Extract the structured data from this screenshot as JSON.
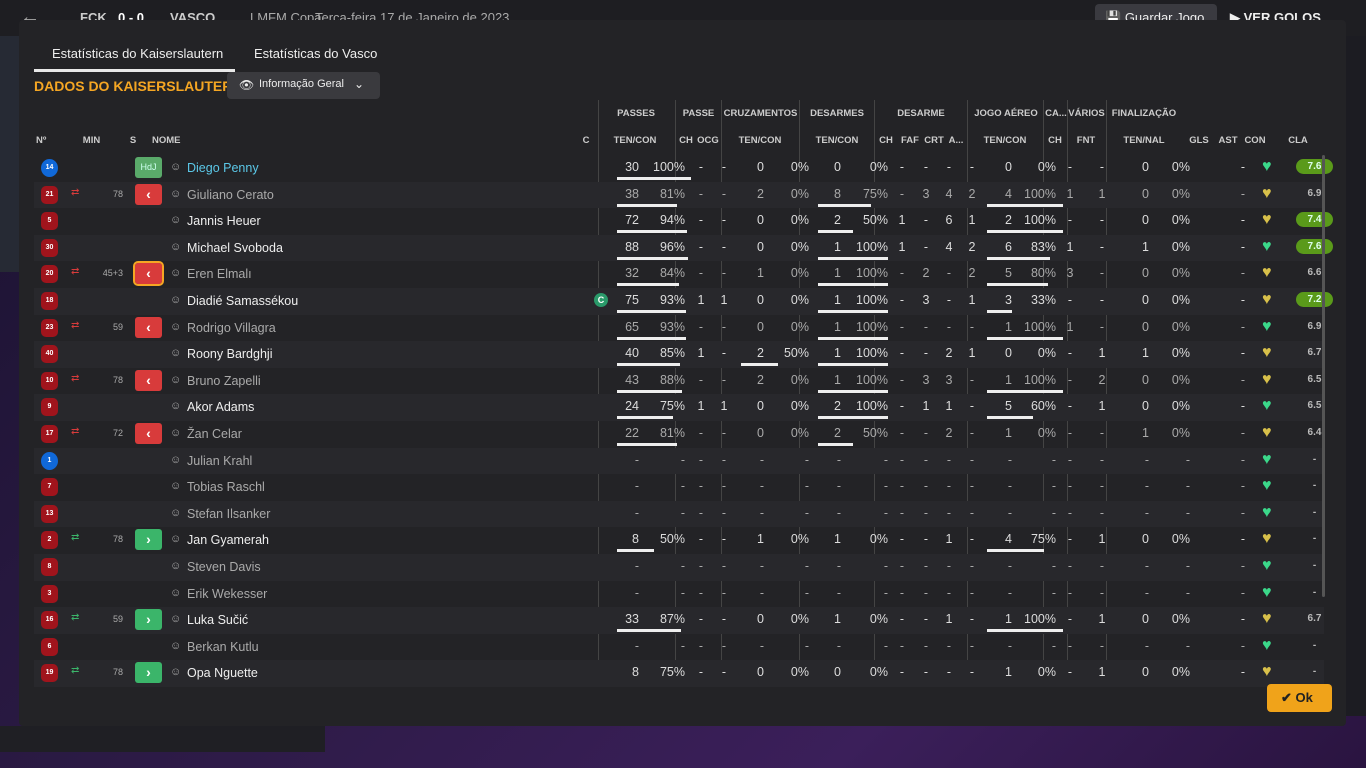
{
  "topbar": {
    "team1": "FCK",
    "score": "0 - 0",
    "team2": "VASCO",
    "competition": "LMFM Copa",
    "date": "Terça-feira 17 de Janeiro de 2023",
    "save_label": "Guardar Jogo",
    "goals_label": "VER GOLOS"
  },
  "tabs": [
    "Estatísticas do Kaiserslautern",
    "Estatísticas do Vasco"
  ],
  "title": "DADOS DO KAISERSLAUTERN",
  "view_select": "Informação Geral",
  "groups": [
    "PASSES",
    "PASSE",
    "CRUZAMENTOS",
    "DESARMES",
    "DESARME",
    "JOGO AÉREO",
    "CA...",
    "VÁRIOS",
    "FINALIZAÇÃO"
  ],
  "columns": {
    "no": "Nº",
    "min": "MIN",
    "s": "S",
    "name": "NOME",
    "c": "C",
    "passes": "TEN/CON",
    "passe_ch": "CH",
    "passe_ocg": "OCG",
    "cruz": "TEN/CON",
    "desarmes": "TEN/CON",
    "des_ch": "CH",
    "des_faf": "FAF",
    "des_crt": "CRT",
    "des_a": "A...",
    "aereo": "TEN/CON",
    "ca_ch": "CH",
    "fnt": "FNT",
    "fin": "TEN/NAL",
    "gls": "GLS",
    "ast": "AST",
    "con": "CON",
    "cla": "CLA"
  },
  "colors": {
    "accent": "#f5a623",
    "good_rating": "#5a9a1a",
    "out": "#d83b3b",
    "in": "#3bb56a"
  },
  "players": [
    {
      "no": "14",
      "kit": "blue",
      "sub": "",
      "min": "",
      "s": "HdJ",
      "name": "Diego Penny",
      "cap": "",
      "p1": "30",
      "p2": "100%",
      "pb": 1.0,
      "ch": "-",
      "ocg": "-",
      "cr1": "0",
      "cr2": "0%",
      "d1": "0",
      "d2": "0%",
      "db": 0,
      "dch": "-",
      "faf": "-",
      "crt": "-",
      "da": "-",
      "a1": "0",
      "a2": "0%",
      "ab": 0,
      "cach": "-",
      "fnt": "-",
      "f1": "0",
      "f2": "0%",
      "gls": "",
      "ast": "-",
      "cla": "7.6",
      "good": true,
      "hl": true
    },
    {
      "no": "21",
      "kit": "red",
      "sub": "out",
      "min": "78",
      "s": "out",
      "name": "Giuliano Cerato",
      "cap": "",
      "p1": "38",
      "p2": "81%",
      "pb": 0.81,
      "ch": "-",
      "ocg": "-",
      "cr1": "2",
      "cr2": "0%",
      "d1": "8",
      "d2": "75%",
      "db": 0.75,
      "dch": "-",
      "faf": "3",
      "crt": "4",
      "da": "2",
      "a1": "4",
      "a2": "100%",
      "ab": 1.0,
      "cach": "1",
      "fnt": "1",
      "f1": "0",
      "f2": "0%",
      "gls": "",
      "ast": "-",
      "cla": "6.9",
      "good": false,
      "dim": true
    },
    {
      "no": "5",
      "kit": "red",
      "sub": "",
      "min": "",
      "s": "",
      "name": "Jannis Heuer",
      "cap": "",
      "p1": "72",
      "p2": "94%",
      "pb": 0.94,
      "ch": "-",
      "ocg": "-",
      "cr1": "0",
      "cr2": "0%",
      "d1": "2",
      "d2": "50%",
      "db": 0.5,
      "dch": "1",
      "faf": "-",
      "crt": "6",
      "da": "1",
      "a1": "2",
      "a2": "100%",
      "ab": 1.0,
      "cach": "-",
      "fnt": "-",
      "f1": "0",
      "f2": "0%",
      "gls": "",
      "ast": "-",
      "cla": "7.4",
      "good": true
    },
    {
      "no": "30",
      "kit": "red",
      "sub": "",
      "min": "",
      "s": "",
      "name": "Michael Svoboda",
      "cap": "",
      "p1": "88",
      "p2": "96%",
      "pb": 0.96,
      "ch": "-",
      "ocg": "-",
      "cr1": "0",
      "cr2": "0%",
      "d1": "1",
      "d2": "100%",
      "db": 1.0,
      "dch": "1",
      "faf": "-",
      "crt": "4",
      "da": "2",
      "a1": "6",
      "a2": "83%",
      "ab": 0.83,
      "cach": "1",
      "fnt": "-",
      "f1": "1",
      "f2": "0%",
      "gls": "",
      "ast": "-",
      "cla": "7.6",
      "good": true
    },
    {
      "no": "20",
      "kit": "red",
      "sub": "out",
      "min": "45+3",
      "s": "out",
      "name": "Eren Elmalı",
      "cap": "",
      "p1": "32",
      "p2": "84%",
      "pb": 0.84,
      "ch": "-",
      "ocg": "-",
      "cr1": "1",
      "cr2": "0%",
      "d1": "1",
      "d2": "100%",
      "db": 1.0,
      "dch": "-",
      "faf": "2",
      "crt": "-",
      "da": "2",
      "a1": "5",
      "a2": "80%",
      "ab": 0.8,
      "cach": "3",
      "fnt": "-",
      "f1": "0",
      "f2": "0%",
      "gls": "",
      "ast": "-",
      "cla": "6.6",
      "good": false,
      "dim": true
    },
    {
      "no": "18",
      "kit": "red",
      "sub": "",
      "min": "",
      "s": "",
      "name": "Diadié Samassékou",
      "cap": "C",
      "p1": "75",
      "p2": "93%",
      "pb": 0.93,
      "ch": "1",
      "ocg": "1",
      "cr1": "0",
      "cr2": "0%",
      "d1": "1",
      "d2": "100%",
      "db": 1.0,
      "dch": "-",
      "faf": "3",
      "crt": "-",
      "da": "1",
      "a1": "3",
      "a2": "33%",
      "ab": 0.33,
      "cach": "-",
      "fnt": "-",
      "f1": "0",
      "f2": "0%",
      "gls": "",
      "ast": "-",
      "cla": "7.2",
      "good": true
    },
    {
      "no": "23",
      "kit": "red",
      "sub": "out",
      "min": "59",
      "s": "out",
      "name": "Rodrigo Villagra",
      "cap": "",
      "p1": "65",
      "p2": "93%",
      "pb": 0.93,
      "ch": "-",
      "ocg": "-",
      "cr1": "0",
      "cr2": "0%",
      "d1": "1",
      "d2": "100%",
      "db": 1.0,
      "dch": "-",
      "faf": "-",
      "crt": "-",
      "da": "-",
      "a1": "1",
      "a2": "100%",
      "ab": 1.0,
      "cach": "1",
      "fnt": "-",
      "f1": "0",
      "f2": "0%",
      "gls": "",
      "ast": "-",
      "cla": "6.9",
      "good": false,
      "dim": true
    },
    {
      "no": "40",
      "kit": "red",
      "sub": "",
      "min": "",
      "s": "",
      "name": "Roony Bardghji",
      "cap": "",
      "p1": "40",
      "p2": "85%",
      "pb": 0.85,
      "ch": "1",
      "ocg": "-",
      "cr1": "2",
      "cr2": "50%",
      "d1": "1",
      "d2": "100%",
      "db": 1.0,
      "dch": "-",
      "faf": "-",
      "crt": "2",
      "da": "1",
      "a1": "0",
      "a2": "0%",
      "ab": 0,
      "cach": "-",
      "fnt": "1",
      "f1": "1",
      "f2": "0%",
      "gls": "",
      "ast": "-",
      "cla": "6.7",
      "good": false,
      "crb": 0.5
    },
    {
      "no": "10",
      "kit": "red",
      "sub": "out",
      "min": "78",
      "s": "out",
      "name": "Bruno Zapelli",
      "cap": "",
      "p1": "43",
      "p2": "88%",
      "pb": 0.88,
      "ch": "-",
      "ocg": "-",
      "cr1": "2",
      "cr2": "0%",
      "d1": "1",
      "d2": "100%",
      "db": 1.0,
      "dch": "-",
      "faf": "3",
      "crt": "3",
      "da": "-",
      "a1": "1",
      "a2": "100%",
      "ab": 1.0,
      "cach": "-",
      "fnt": "2",
      "f1": "0",
      "f2": "0%",
      "gls": "",
      "ast": "-",
      "cla": "6.5",
      "good": false,
      "dim": true
    },
    {
      "no": "9",
      "kit": "red",
      "sub": "",
      "min": "",
      "s": "",
      "name": "Akor Adams",
      "cap": "",
      "p1": "24",
      "p2": "75%",
      "pb": 0.75,
      "ch": "1",
      "ocg": "1",
      "cr1": "0",
      "cr2": "0%",
      "d1": "2",
      "d2": "100%",
      "db": 1.0,
      "dch": "-",
      "faf": "1",
      "crt": "1",
      "da": "-",
      "a1": "5",
      "a2": "60%",
      "ab": 0.6,
      "cach": "-",
      "fnt": "1",
      "f1": "0",
      "f2": "0%",
      "gls": "",
      "ast": "-",
      "cla": "6.5",
      "good": false
    },
    {
      "no": "17",
      "kit": "red",
      "sub": "out",
      "min": "72",
      "s": "out",
      "name": "Žan Celar",
      "cap": "",
      "p1": "22",
      "p2": "81%",
      "pb": 0.81,
      "ch": "-",
      "ocg": "-",
      "cr1": "0",
      "cr2": "0%",
      "d1": "2",
      "d2": "50%",
      "db": 0.5,
      "dch": "-",
      "faf": "-",
      "crt": "2",
      "da": "-",
      "a1": "1",
      "a2": "0%",
      "ab": 0,
      "cach": "-",
      "fnt": "-",
      "f1": "1",
      "f2": "0%",
      "gls": "",
      "ast": "-",
      "cla": "6.4",
      "good": false,
      "dim": true
    },
    {
      "no": "1",
      "kit": "blue",
      "sub": "",
      "min": "",
      "s": "",
      "name": "Julian Krahl",
      "cap": "",
      "p1": "-",
      "p2": "-",
      "pb": 0,
      "ch": "-",
      "ocg": "-",
      "cr1": "-",
      "cr2": "-",
      "d1": "-",
      "d2": "-",
      "db": 0,
      "dch": "-",
      "faf": "-",
      "crt": "-",
      "da": "-",
      "a1": "-",
      "a2": "-",
      "ab": 0,
      "cach": "-",
      "fnt": "-",
      "f1": "-",
      "f2": "-",
      "gls": "",
      "ast": "-",
      "cla": "-",
      "good": false,
      "dim": true
    },
    {
      "no": "7",
      "kit": "red",
      "sub": "",
      "min": "",
      "s": "",
      "name": "Tobias Raschl",
      "cap": "",
      "p1": "-",
      "p2": "-",
      "pb": 0,
      "ch": "-",
      "ocg": "-",
      "cr1": "-",
      "cr2": "-",
      "d1": "-",
      "d2": "-",
      "db": 0,
      "dch": "-",
      "faf": "-",
      "crt": "-",
      "da": "-",
      "a1": "-",
      "a2": "-",
      "ab": 0,
      "cach": "-",
      "fnt": "-",
      "f1": "-",
      "f2": "-",
      "gls": "",
      "ast": "-",
      "cla": "-",
      "good": false,
      "dim": true
    },
    {
      "no": "13",
      "kit": "red",
      "sub": "",
      "min": "",
      "s": "",
      "name": "Stefan Ilsanker",
      "cap": "",
      "p1": "-",
      "p2": "-",
      "pb": 0,
      "ch": "-",
      "ocg": "-",
      "cr1": "-",
      "cr2": "-",
      "d1": "-",
      "d2": "-",
      "db": 0,
      "dch": "-",
      "faf": "-",
      "crt": "-",
      "da": "-",
      "a1": "-",
      "a2": "-",
      "ab": 0,
      "cach": "-",
      "fnt": "-",
      "f1": "-",
      "f2": "-",
      "gls": "",
      "ast": "-",
      "cla": "-",
      "good": false,
      "dim": true
    },
    {
      "no": "2",
      "kit": "red",
      "sub": "in",
      "min": "78",
      "s": "in",
      "name": "Jan Gyamerah",
      "cap": "",
      "p1": "8",
      "p2": "50%",
      "pb": 0.5,
      "ch": "-",
      "ocg": "-",
      "cr1": "1",
      "cr2": "0%",
      "d1": "1",
      "d2": "0%",
      "db": 0,
      "dch": "-",
      "faf": "-",
      "crt": "1",
      "da": "-",
      "a1": "4",
      "a2": "75%",
      "ab": 0.75,
      "cach": "-",
      "fnt": "1",
      "f1": "0",
      "f2": "0%",
      "gls": "",
      "ast": "-",
      "cla": "-",
      "good": false
    },
    {
      "no": "8",
      "kit": "red",
      "sub": "",
      "min": "",
      "s": "",
      "name": "Steven Davis",
      "cap": "",
      "p1": "-",
      "p2": "-",
      "pb": 0,
      "ch": "-",
      "ocg": "-",
      "cr1": "-",
      "cr2": "-",
      "d1": "-",
      "d2": "-",
      "db": 0,
      "dch": "-",
      "faf": "-",
      "crt": "-",
      "da": "-",
      "a1": "-",
      "a2": "-",
      "ab": 0,
      "cach": "-",
      "fnt": "-",
      "f1": "-",
      "f2": "-",
      "gls": "",
      "ast": "-",
      "cla": "-",
      "good": false,
      "dim": true
    },
    {
      "no": "3",
      "kit": "red",
      "sub": "",
      "min": "",
      "s": "",
      "name": "Erik Wekesser",
      "cap": "",
      "p1": "-",
      "p2": "-",
      "pb": 0,
      "ch": "-",
      "ocg": "-",
      "cr1": "-",
      "cr2": "-",
      "d1": "-",
      "d2": "-",
      "db": 0,
      "dch": "-",
      "faf": "-",
      "crt": "-",
      "da": "-",
      "a1": "-",
      "a2": "-",
      "ab": 0,
      "cach": "-",
      "fnt": "-",
      "f1": "-",
      "f2": "-",
      "gls": "",
      "ast": "-",
      "cla": "-",
      "good": false,
      "dim": true
    },
    {
      "no": "16",
      "kit": "red",
      "sub": "in",
      "min": "59",
      "s": "in",
      "name": "Luka Sučić",
      "cap": "",
      "p1": "33",
      "p2": "87%",
      "pb": 0.87,
      "ch": "-",
      "ocg": "-",
      "cr1": "0",
      "cr2": "0%",
      "d1": "1",
      "d2": "0%",
      "db": 0,
      "dch": "-",
      "faf": "-",
      "crt": "1",
      "da": "-",
      "a1": "1",
      "a2": "100%",
      "ab": 1.0,
      "cach": "-",
      "fnt": "1",
      "f1": "0",
      "f2": "0%",
      "gls": "",
      "ast": "-",
      "cla": "6.7",
      "good": false
    },
    {
      "no": "6",
      "kit": "red",
      "sub": "",
      "min": "",
      "s": "",
      "name": "Berkan Kutlu",
      "cap": "",
      "p1": "-",
      "p2": "-",
      "pb": 0,
      "ch": "-",
      "ocg": "-",
      "cr1": "-",
      "cr2": "-",
      "d1": "-",
      "d2": "-",
      "db": 0,
      "dch": "-",
      "faf": "-",
      "crt": "-",
      "da": "-",
      "a1": "-",
      "a2": "-",
      "ab": 0,
      "cach": "-",
      "fnt": "-",
      "f1": "-",
      "f2": "-",
      "gls": "",
      "ast": "-",
      "cla": "-",
      "good": false,
      "dim": true
    },
    {
      "no": "19",
      "kit": "red",
      "sub": "in",
      "min": "78",
      "s": "in",
      "name": "Opa Nguette",
      "cap": "",
      "p1": "8",
      "p2": "75%",
      "pb": 0,
      "ch": "-",
      "ocg": "-",
      "cr1": "0",
      "cr2": "0%",
      "d1": "0",
      "d2": "0%",
      "db": 0,
      "dch": "-",
      "faf": "-",
      "crt": "-",
      "da": "-",
      "a1": "1",
      "a2": "0%",
      "ab": 0,
      "cach": "-",
      "fnt": "1",
      "f1": "0",
      "f2": "0%",
      "gls": "",
      "ast": "-",
      "cla": "-",
      "good": false
    }
  ],
  "ok_label": "Ok"
}
